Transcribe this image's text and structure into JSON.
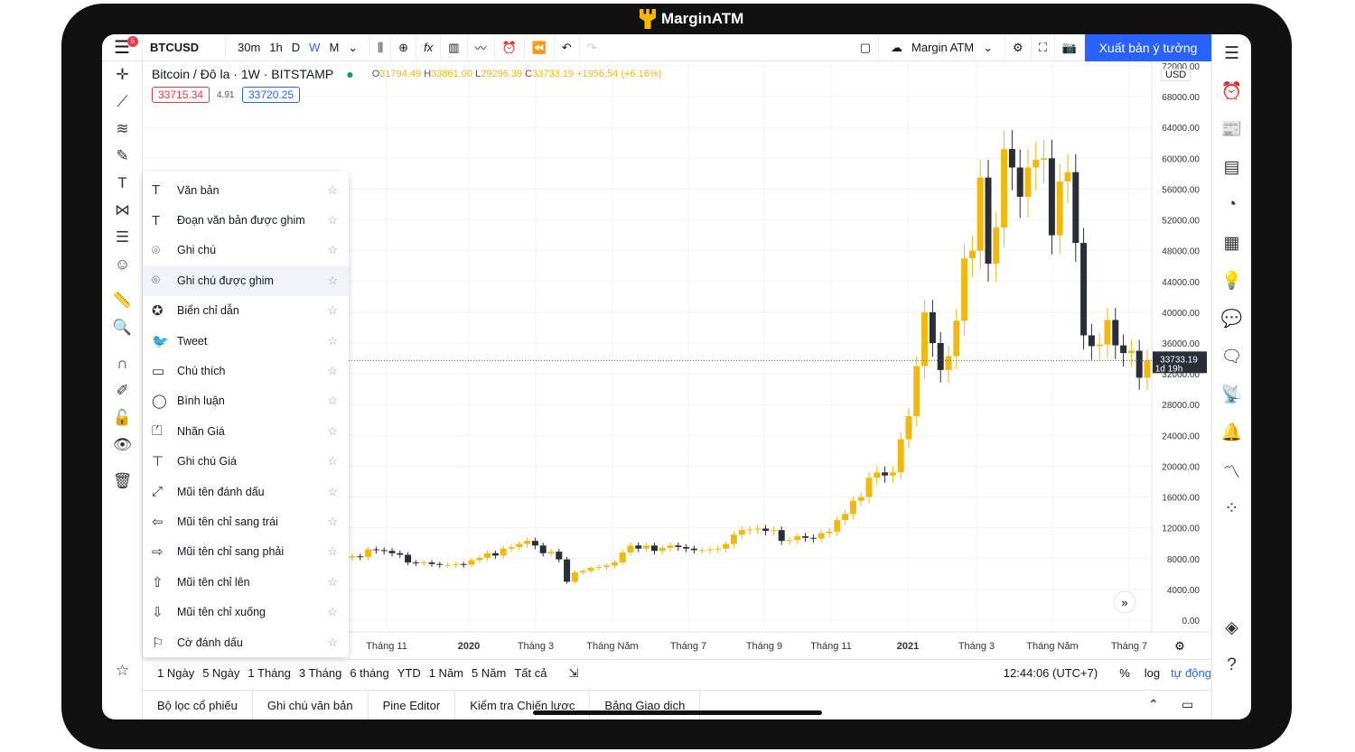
{
  "app_title": "MarginATM",
  "topbar": {
    "menu_badge": "5",
    "symbol": "BTCUSD",
    "intervals": [
      "30m",
      "1h",
      "D",
      "W",
      "M"
    ],
    "active_interval": "W",
    "layout_name": "Margin ATM",
    "publish": "Xuất bản ý tưởng"
  },
  "legend": {
    "title": "Bitcoin / Đô la · 1W · BITSTAMP",
    "o": "31794.49",
    "h": "33861.00",
    "l": "29296.39",
    "c": "33733.19",
    "change": "+1956.54 (+6.16%)",
    "bid": "33715.34",
    "spread": "4.91",
    "ask": "33720.25"
  },
  "currency": "USD",
  "last_price": "33733.19",
  "countdown": "1d 19h",
  "menu": [
    {
      "label": "Văn bản",
      "icon": "text-icon"
    },
    {
      "label": "Đoạn văn bản được ghim",
      "icon": "anchored-text-icon"
    },
    {
      "label": "Ghi chú",
      "icon": "note-icon"
    },
    {
      "label": "Ghi chú được ghim",
      "icon": "anchored-note-icon",
      "highlighted": true
    },
    {
      "label": "Biển chỉ dẫn",
      "icon": "signpost-icon"
    },
    {
      "label": "Tweet",
      "icon": "tweet-icon"
    },
    {
      "label": "Chú thích",
      "icon": "callout-icon"
    },
    {
      "label": "Bình luận",
      "icon": "comment-icon"
    },
    {
      "label": "Nhãn Giá",
      "icon": "price-label-icon"
    },
    {
      "label": "Ghi chú Giá",
      "icon": "price-note-icon"
    },
    {
      "label": "Mũi tên đánh dấu",
      "icon": "arrow-marker-icon"
    },
    {
      "label": "Mũi tên chỉ sang trái",
      "icon": "arrow-left-icon"
    },
    {
      "label": "Mũi tên chỉ sang phải",
      "icon": "arrow-right-icon"
    },
    {
      "label": "Mũi tên chỉ lên",
      "icon": "arrow-up-icon"
    },
    {
      "label": "Mũi tên chỉ xuống",
      "icon": "arrow-down-icon"
    },
    {
      "label": "Cờ đánh dấu",
      "icon": "flag-icon"
    }
  ],
  "ranges": [
    "1 Ngày",
    "5 Ngày",
    "1 Tháng",
    "3 Tháng",
    "6 tháng",
    "YTD",
    "1 Năm",
    "5 Năm",
    "Tất cả"
  ],
  "clock": "12:44:06 (UTC+7)",
  "scale_pct": "%",
  "scale_log": "log",
  "scale_auto": "tự động",
  "bottom_tabs": [
    "Bộ lọc cổ phiếu",
    "Ghi chú văn bản",
    "Pine Editor",
    "Kiểm tra Chiến lược",
    "Bảng Giao dịch"
  ],
  "colors": {
    "up": "#f0b90b",
    "down": "#2a2e39",
    "accent": "#2962ff"
  },
  "chart_data": {
    "type": "candlestick",
    "y_ticks": [
      "72000.00",
      "68000.00",
      "64000.00",
      "60000.00",
      "56000.00",
      "52000.00",
      "48000.00",
      "44000.00",
      "40000.00",
      "36000.00",
      "32000.00",
      "28000.00",
      "24000.00",
      "20000.00",
      "16000.00",
      "12000.00",
      "8000.00",
      "4000.00",
      "0.00"
    ],
    "ylim": [
      0,
      72000
    ],
    "x_ticks": [
      "Tháng 11",
      "2020",
      "Tháng 3",
      "Tháng Năm",
      "Tháng 7",
      "Tháng 9",
      "Tháng 11",
      "2021",
      "Tháng 3",
      "Tháng Năm",
      "Tháng 7"
    ],
    "weekly_close": [
      8300,
      8200,
      9200,
      9100,
      9000,
      8700,
      8500,
      7500,
      7400,
      7500,
      7300,
      7200,
      7200,
      7300,
      7200,
      7800,
      8100,
      8700,
      8400,
      9300,
      9500,
      9900,
      10300,
      9700,
      8700,
      8900,
      7900,
      5000,
      6200,
      6400,
      6800,
      6900,
      7100,
      7500,
      8800,
      9700,
      9300,
      9700,
      9000,
      9400,
      9700,
      9500,
      9300,
      9100,
      9100,
      9200,
      9300,
      9900,
      11100,
      11700,
      11800,
      11900,
      11600,
      11700,
      10300,
      10400,
      10900,
      10700,
      10600,
      11300,
      11500,
      13000,
      13800,
      15500,
      16000,
      18500,
      19200,
      18800,
      19200,
      23500,
      26500,
      33000,
      40000,
      36000,
      32500,
      34300,
      38900,
      47000,
      48000,
      57500,
      46300,
      51000,
      61200,
      58800,
      55000,
      58800,
      59800,
      60000,
      50000,
      57000,
      58200,
      49000,
      37000,
      35600,
      35800,
      39000,
      35700,
      34700,
      35000,
      31500,
      33733
    ]
  }
}
